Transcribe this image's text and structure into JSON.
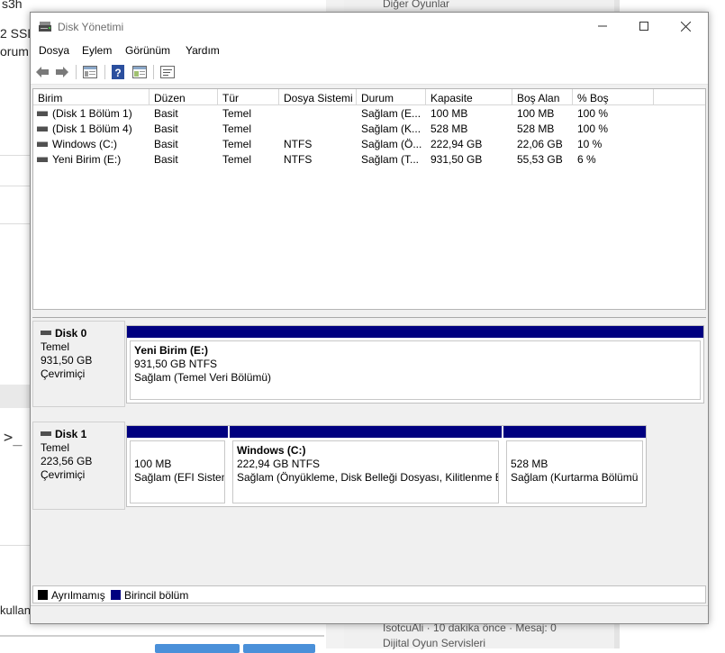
{
  "background": {
    "left_fragments": [
      "s3h",
      "2 SSD",
      "orum",
      "kullan"
    ],
    "right_fragments": [
      "Diğer Oyunlar",
      "IsotcuAli · 10 dakika önce · Mesaj: 0",
      "Dijital Oyun Servisleri"
    ],
    "prompt_glyph": ">_"
  },
  "window": {
    "title": "Disk Yönetimi",
    "menu": [
      "Dosya",
      "Eylem",
      "Görünüm",
      "Yardım"
    ],
    "columns": [
      "Birim",
      "Düzen",
      "Tür",
      "Dosya Sistemi",
      "Durum",
      "Kapasite",
      "Boş Alan",
      "% Boş"
    ],
    "volumes": [
      {
        "name": "(Disk 1 Bölüm 1)",
        "layout": "Basit",
        "type": "Temel",
        "fs": "",
        "status": "Sağlam (E...",
        "capacity": "100 MB",
        "free": "100 MB",
        "pct": "100 %"
      },
      {
        "name": "(Disk 1 Bölüm 4)",
        "layout": "Basit",
        "type": "Temel",
        "fs": "",
        "status": "Sağlam (K...",
        "capacity": "528 MB",
        "free": "528 MB",
        "pct": "100 %"
      },
      {
        "name": "Windows (C:)",
        "layout": "Basit",
        "type": "Temel",
        "fs": "NTFS",
        "status": "Sağlam (Ö...",
        "capacity": "222,94 GB",
        "free": "22,06 GB",
        "pct": "10 %"
      },
      {
        "name": "Yeni Birim (E:)",
        "layout": "Basit",
        "type": "Temel",
        "fs": "NTFS",
        "status": "Sağlam (T...",
        "capacity": "931,50 GB",
        "free": "55,53 GB",
        "pct": "6 %"
      }
    ],
    "disks": [
      {
        "name": "Disk 0",
        "type": "Temel",
        "size": "931,50 GB",
        "state": "Çevrimiçi",
        "partitions": [
          {
            "name": "Yeni Birim  (E:)",
            "size": "931,50 GB NTFS",
            "status": "Sağlam (Temel Veri Bölümü)"
          }
        ]
      },
      {
        "name": "Disk 1",
        "type": "Temel",
        "size": "223,56 GB",
        "state": "Çevrimiçi",
        "partitions": [
          {
            "name": "",
            "size": "100 MB",
            "status": "Sağlam (EFI Sistem"
          },
          {
            "name": "Windows  (C:)",
            "size": "222,94 GB NTFS",
            "status": "Sağlam (Önyükleme, Disk Belleği Dosyası, Kilitlenme Bi"
          },
          {
            "name": "",
            "size": "528 MB",
            "status": "Sağlam (Kurtarma Bölümü"
          }
        ]
      }
    ],
    "legend": [
      {
        "label": "Ayrılmamış",
        "color": "#000000"
      },
      {
        "label": "Birincil bölüm",
        "color": "#000080"
      }
    ]
  }
}
